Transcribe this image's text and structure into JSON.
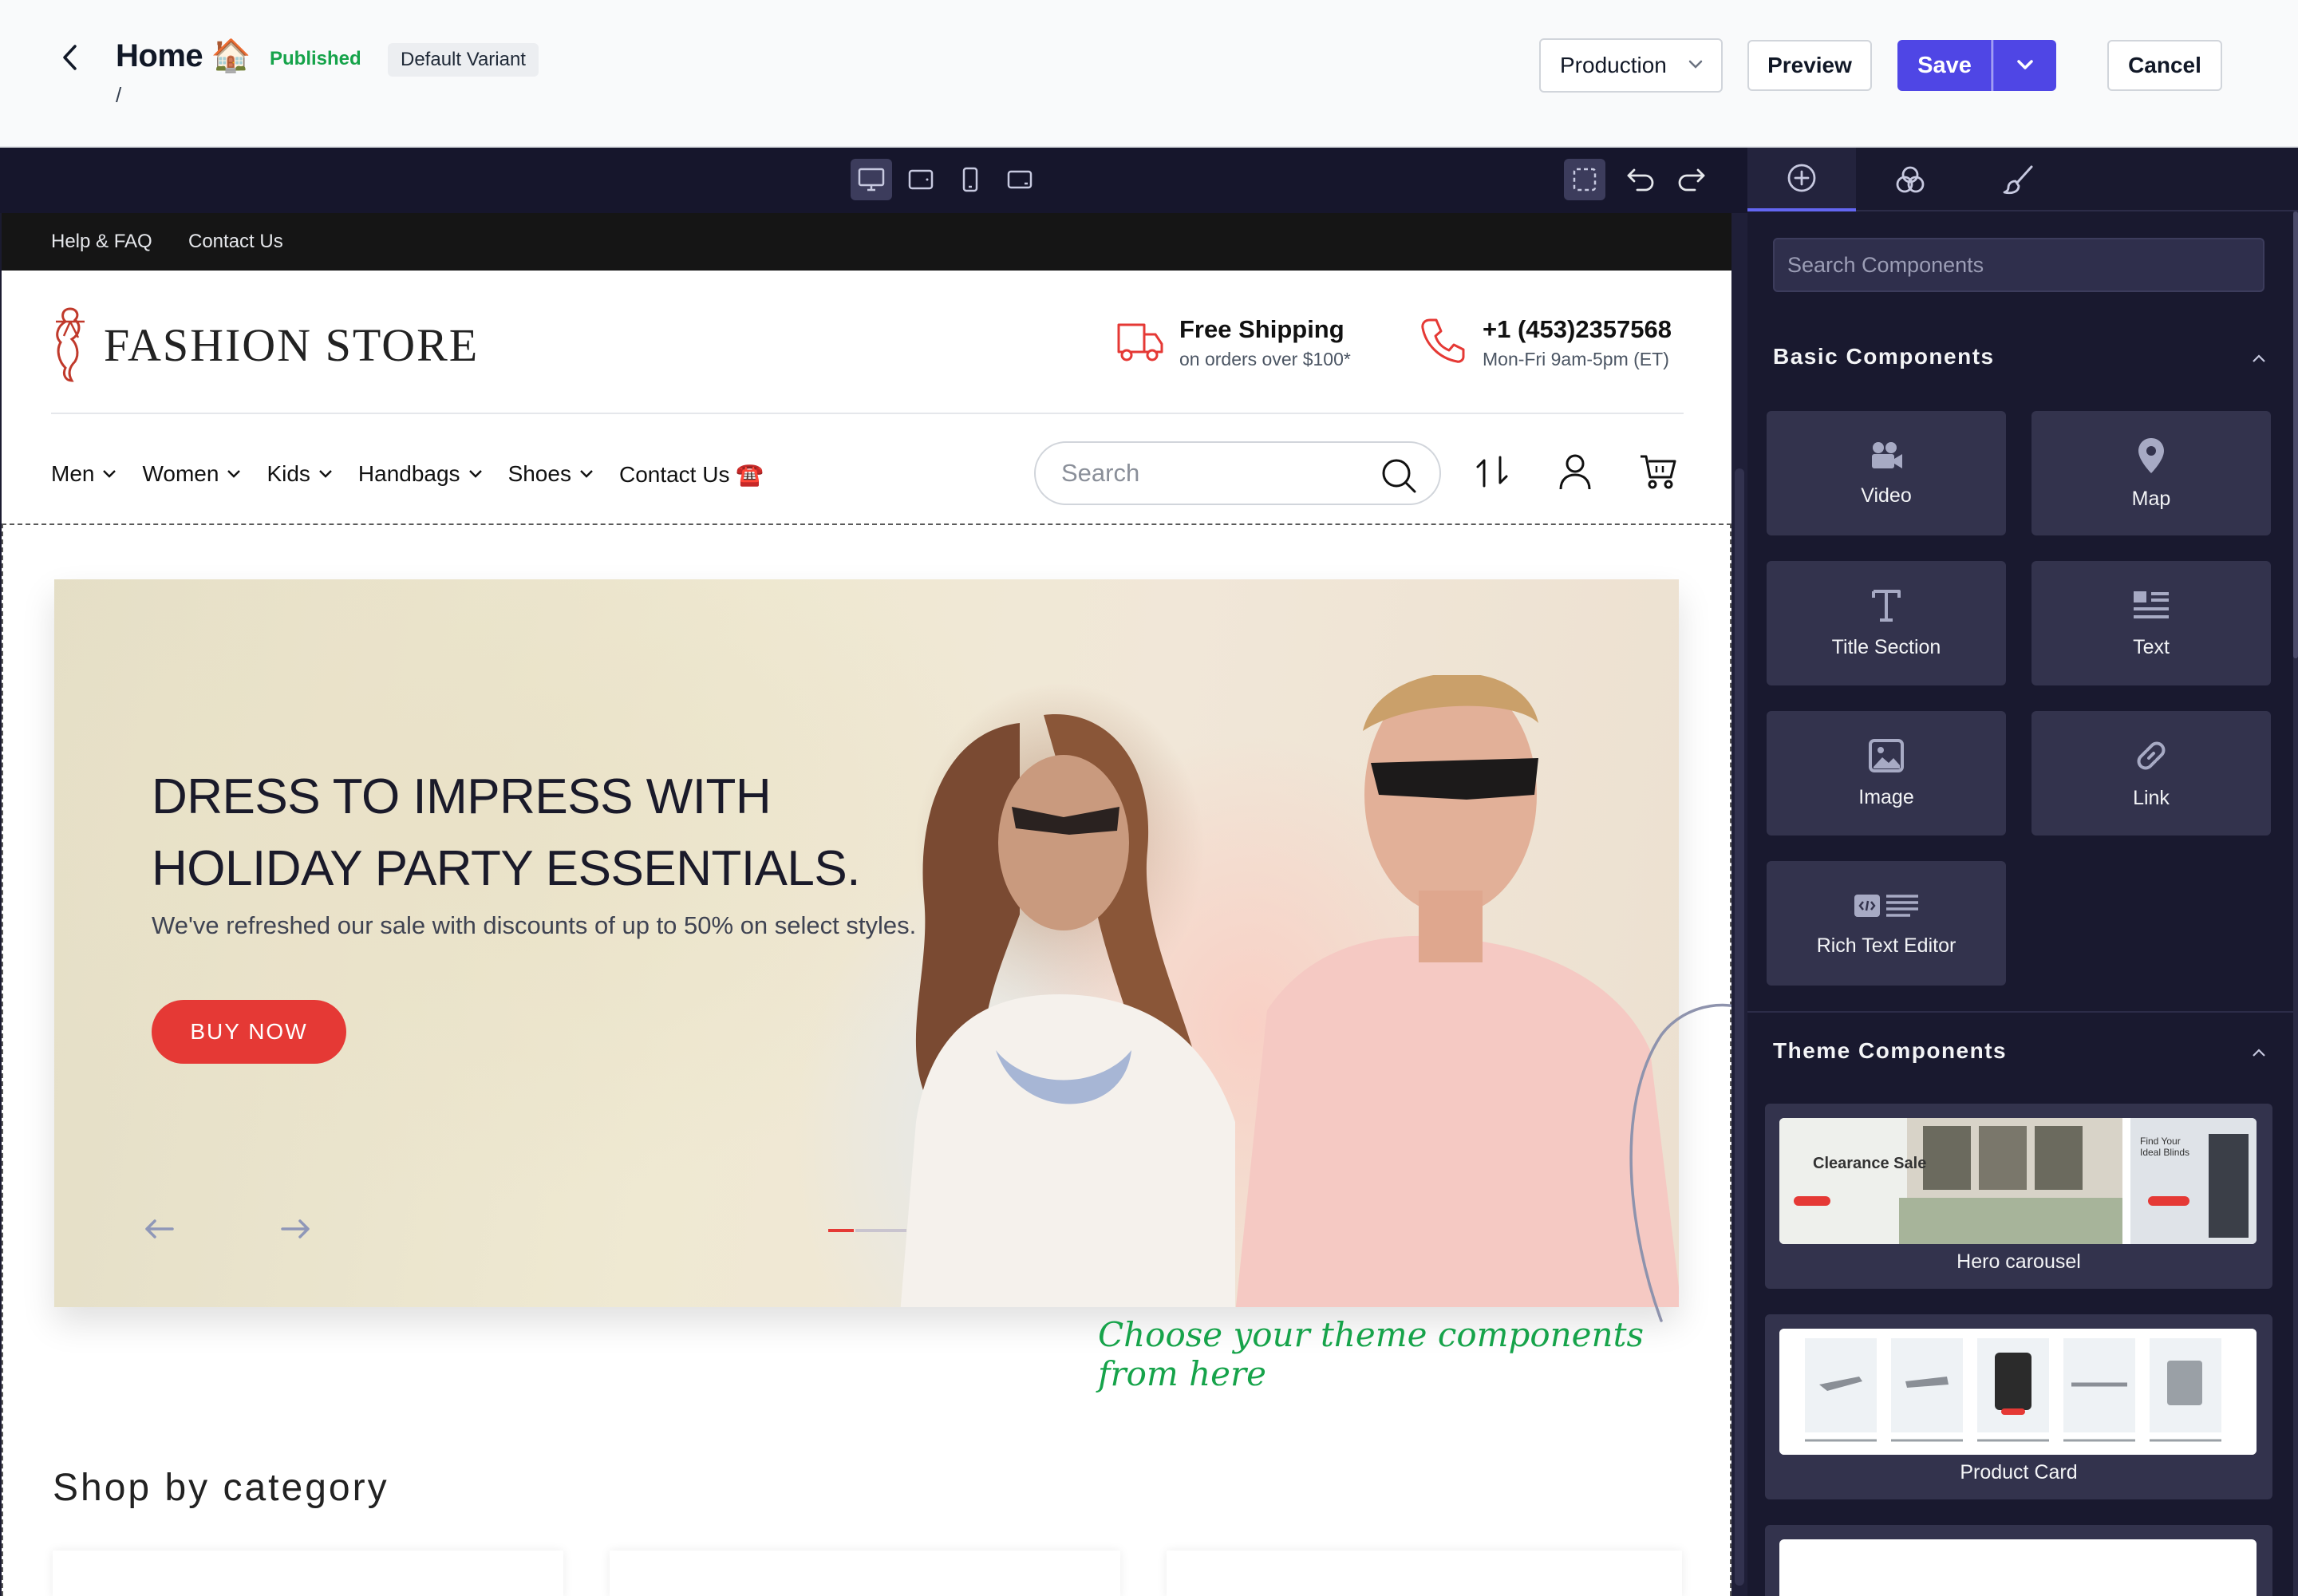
{
  "topbar": {
    "title": "Home 🏠",
    "status": "Published",
    "variant": "Default Variant",
    "breadcrumb": "/",
    "environment": "Production",
    "preview_label": "Preview",
    "save_label": "Save",
    "cancel_label": "Cancel"
  },
  "canvas_toolbar": {
    "devices": [
      "desktop-icon",
      "tablet-icon",
      "mobile-icon",
      "tablet-landscape-icon"
    ],
    "active_device": "desktop-icon"
  },
  "sidebar": {
    "tabs": [
      "add-icon",
      "layers-icon",
      "brush-icon"
    ],
    "active_tab": "add-icon",
    "search_placeholder": "Search Components",
    "basic_title": "Basic Components",
    "basic_components": [
      {
        "label": "Video",
        "icon": "video-icon"
      },
      {
        "label": "Map",
        "icon": "map-pin-icon"
      },
      {
        "label": "Title Section",
        "icon": "title-icon"
      },
      {
        "label": "Text",
        "icon": "text-icon"
      },
      {
        "label": "Image",
        "icon": "image-icon"
      },
      {
        "label": "Link",
        "icon": "link-icon"
      },
      {
        "label": "Rich Text Editor",
        "icon": "rich-text-icon"
      }
    ],
    "theme_title": "Theme Components",
    "theme_components": [
      {
        "label": "Hero carousel",
        "thumb_heading": "Clearance Sale",
        "thumb_aside": "Find Your Ideal Blinds"
      },
      {
        "label": "Product Card"
      }
    ]
  },
  "store": {
    "util_links": [
      "Help & FAQ",
      "Contact Us"
    ],
    "logo": "FASHION STORE",
    "shipping_title": "Free Shipping",
    "shipping_sub": "on orders over $100*",
    "phone_title": "+1 (453)2357568",
    "phone_sub": "Mon-Fri 9am-5pm (ET)",
    "nav": [
      "Men",
      "Women",
      "Kids",
      "Handbags",
      "Shoes",
      "Contact Us ☎️"
    ],
    "search_placeholder": "Search",
    "hero": {
      "title_line1": "DRESS TO IMPRESS WITH",
      "title_line2": "HOLIDAY PARTY ESSENTIALS.",
      "subtitle": "We've refreshed our sale with discounts of up to 50% on select styles.",
      "button": "BUY NOW"
    },
    "annotation": "Choose your theme components from here",
    "shop_title": "Shop by category"
  },
  "colors": {
    "primary": "#4f46e5",
    "sidebar_bg": "#19192f",
    "hero_button": "#e53935",
    "annotation": "#16a34a"
  }
}
